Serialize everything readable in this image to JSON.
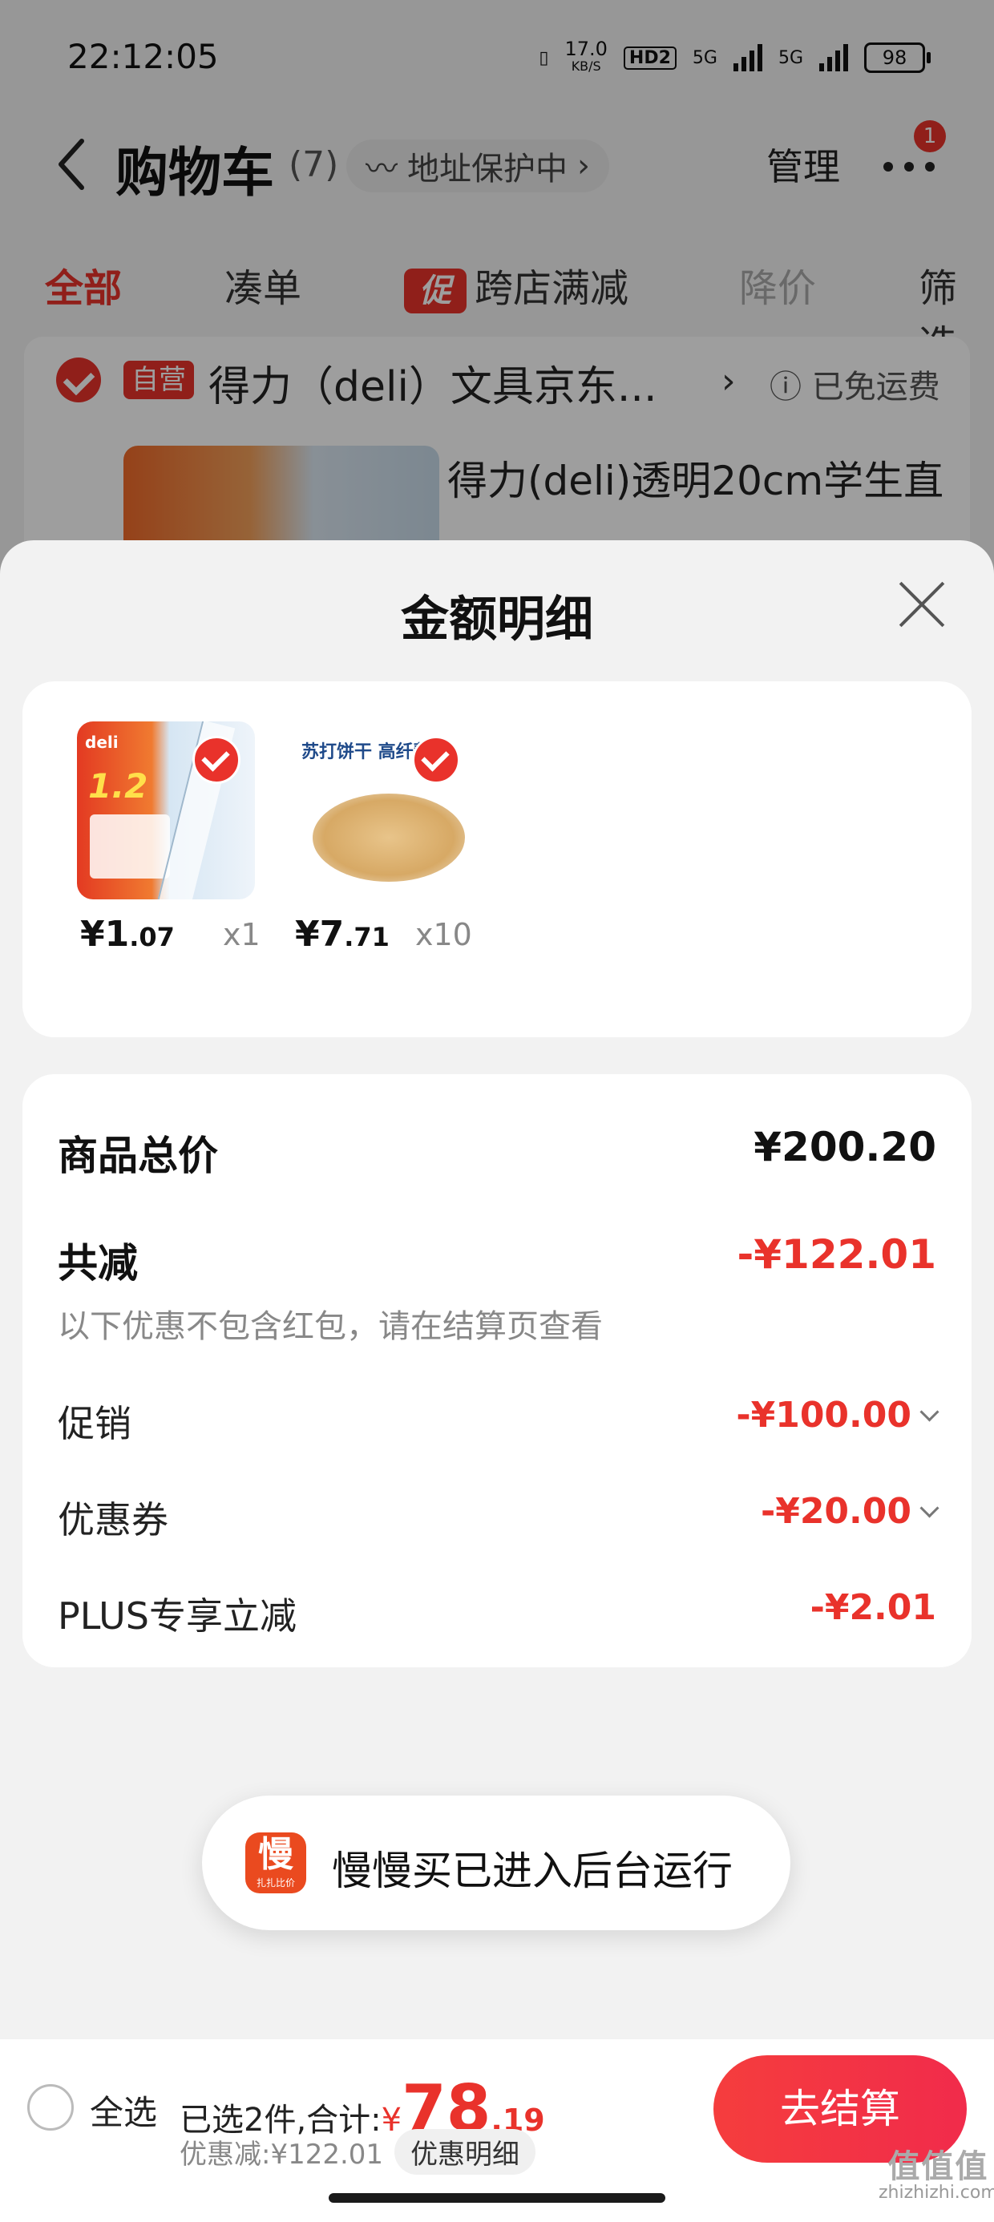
{
  "status_bar": {
    "time": "22:12:05",
    "net_speed": "17.0",
    "net_unit": "KB/S",
    "hd": "HD2",
    "sig1": "5G",
    "sig2": "5G",
    "battery": "98"
  },
  "nav": {
    "title": "购物车",
    "count": "(7)",
    "address": "地址保护中",
    "manage": "管理",
    "badge": "1"
  },
  "tabs": {
    "all": "全部",
    "bundle": "凑单",
    "promo_tag": "促",
    "promo": "跨店满减",
    "price_drop": "降价",
    "filter": "筛选"
  },
  "shop": {
    "tag": "自营",
    "name": "得力（deli）文具京东...",
    "arrow": "›",
    "shipping": "ⓘ 已免运费",
    "product_title": "得力(deli)透明20cm学生直"
  },
  "sheet": {
    "title": "金额明细",
    "items": [
      {
        "price_int": "¥1",
        "price_dec": ".07",
        "qty": "x1",
        "brand": "deli",
        "badge": "1.2"
      },
      {
        "price_int": "¥7",
        "price_dec": ".71",
        "qty": "x10",
        "brand": "苏打饼干 高纤藜麦"
      }
    ],
    "total_label": "商品总价",
    "total_value": "¥200.20",
    "reduce_label": "共减",
    "reduce_value": "-¥122.01",
    "note": "以下优惠不包含红包，请在结算页查看",
    "promo_label": "促销",
    "promo_value": "-¥100.00",
    "coupon_label": "优惠券",
    "coupon_value": "-¥20.00",
    "plus_label": "PLUS专享立减",
    "plus_value": "-¥2.01"
  },
  "toast": {
    "icon_text": "慢",
    "icon_sub": "扎扎比价",
    "text": "慢慢买已进入后台运行"
  },
  "checkout": {
    "select_all": "全选",
    "selected": "已选2件,合计:",
    "currency": "¥",
    "amount_int": "78",
    "amount_dec": ".19",
    "discount": "优惠减:¥122.01",
    "detail_chip": "优惠明细",
    "pay": "去结算"
  },
  "watermark": {
    "logo": "值值值",
    "site": "zhizhizhi.com"
  },
  "colors": {
    "accent": "#e9322b",
    "overlay": "rgba(0,0,0,0.38)"
  }
}
